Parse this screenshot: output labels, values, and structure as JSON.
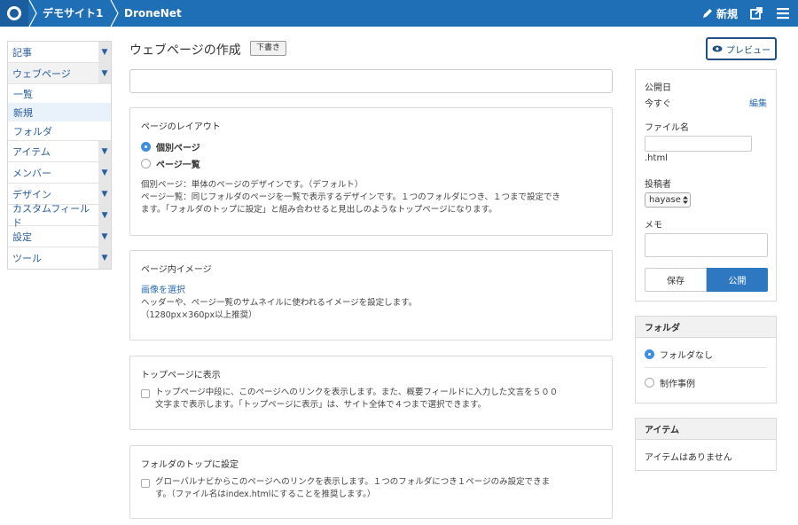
{
  "topbar": {
    "site_name": "デモサイト1",
    "app_name": "DroneNet",
    "new_label": "新規",
    "icons": [
      "logo-icon",
      "pencil-icon",
      "external-link-icon",
      "menu-icon"
    ]
  },
  "sidebar": {
    "items": [
      {
        "label": "記事"
      },
      {
        "label": "ウェブページ"
      },
      {
        "label": "アイテム"
      },
      {
        "label": "メンバー"
      },
      {
        "label": "デザイン"
      },
      {
        "label": "カスタムフィールド"
      },
      {
        "label": "設定"
      },
      {
        "label": "ツール"
      }
    ],
    "subitems": [
      {
        "label": "一覧"
      },
      {
        "label": "新規"
      },
      {
        "label": "フォルダ"
      }
    ],
    "arrow_glyph": "▼"
  },
  "header": {
    "title": "ウェブページの作成",
    "badge": "下書き",
    "preview_label": "プレビュー"
  },
  "layout_panel": {
    "heading": "ページのレイアウト",
    "options": [
      {
        "label": "個別ページ",
        "selected": true
      },
      {
        "label": "ページ一覧",
        "selected": false
      }
    ],
    "desc_lines": [
      "個別ページ：単体のページのデザインです。（デフォルト）",
      "ページ一覧：同じフォルダのページを一覧で表示するデザインです。１つのフォルダにつき、１つまで設定でき",
      "ます。「フォルダのトップに設定」と組み合わせると見出しのようなトップページになります。"
    ]
  },
  "image_panel": {
    "heading": "ページ内イメージ",
    "link": "画像を選択",
    "desc_lines": [
      "ヘッダーや、ページ一覧のサムネイルに使われるイメージを設定します。",
      "（1280px×360px以上推奨）"
    ]
  },
  "top_panel": {
    "heading": "トップページに表示",
    "desc_lines": [
      "トップページ中段に、このページへのリンクを表示します。また、概要フィールドに入力した文言を５００",
      "文字まで表示します。「トップページに表示」は、サイト全体で４つまで選択できます。"
    ]
  },
  "folder_top_panel": {
    "heading": "フォルダのトップに設定",
    "desc_lines": [
      "グローバルナビからこのページへのリンクを表示します。１つのフォルダにつき１ページのみ設定できま",
      "す。（ファイル名はindex.htmlにすることを推奨します。）"
    ]
  },
  "publish_panel": {
    "date_label": "公開日",
    "date_value": "今すぐ",
    "edit_label": "編集",
    "filename_label": "ファイル名",
    "filename_suffix": ".html",
    "author_label": "投稿者",
    "author_value": "hayase",
    "memo_label": "メモ",
    "save_label": "保存",
    "publish_label": "公開"
  },
  "folder_panel": {
    "heading": "フォルダ",
    "options": [
      {
        "label": "フォルダなし",
        "selected": true
      },
      {
        "label": "制作事例",
        "selected": false
      }
    ]
  },
  "item_panel": {
    "heading": "アイテム",
    "empty_text": "アイテムはありません"
  },
  "colors": {
    "topbar": "#1f6fb7",
    "accent": "#2e78c2",
    "link": "#2a6cb0"
  }
}
